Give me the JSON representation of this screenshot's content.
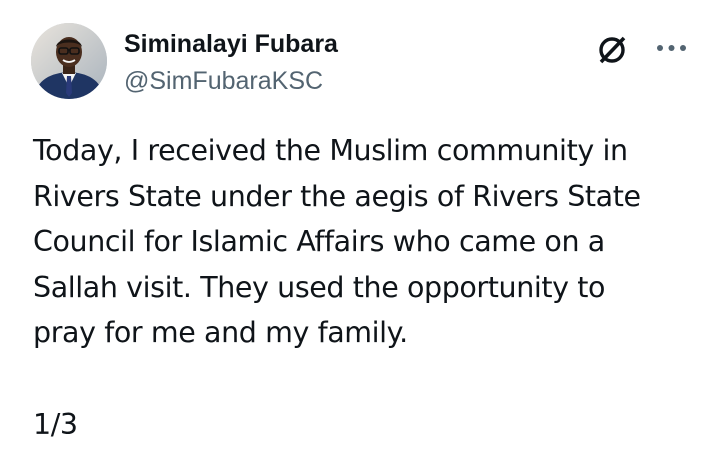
{
  "author": {
    "display_name": "Siminalayi Fubara",
    "handle": "@SimFubaraKSC",
    "avatar_icon": "profile-photo"
  },
  "actions": {
    "grok_icon": "grok-icon",
    "more_icon": "more-options-icon"
  },
  "tweet": {
    "lines": [
      "Today, I received the Muslim community in",
      "Rivers State under the aegis of Rivers State",
      "Council for Islamic Affairs who came on a",
      "Sallah visit. They used the opportunity to",
      "pray for me and my family."
    ],
    "thread_count": "1/3"
  },
  "colors": {
    "text": "#0f1419",
    "secondary_text": "#536471",
    "background": "#ffffff"
  }
}
